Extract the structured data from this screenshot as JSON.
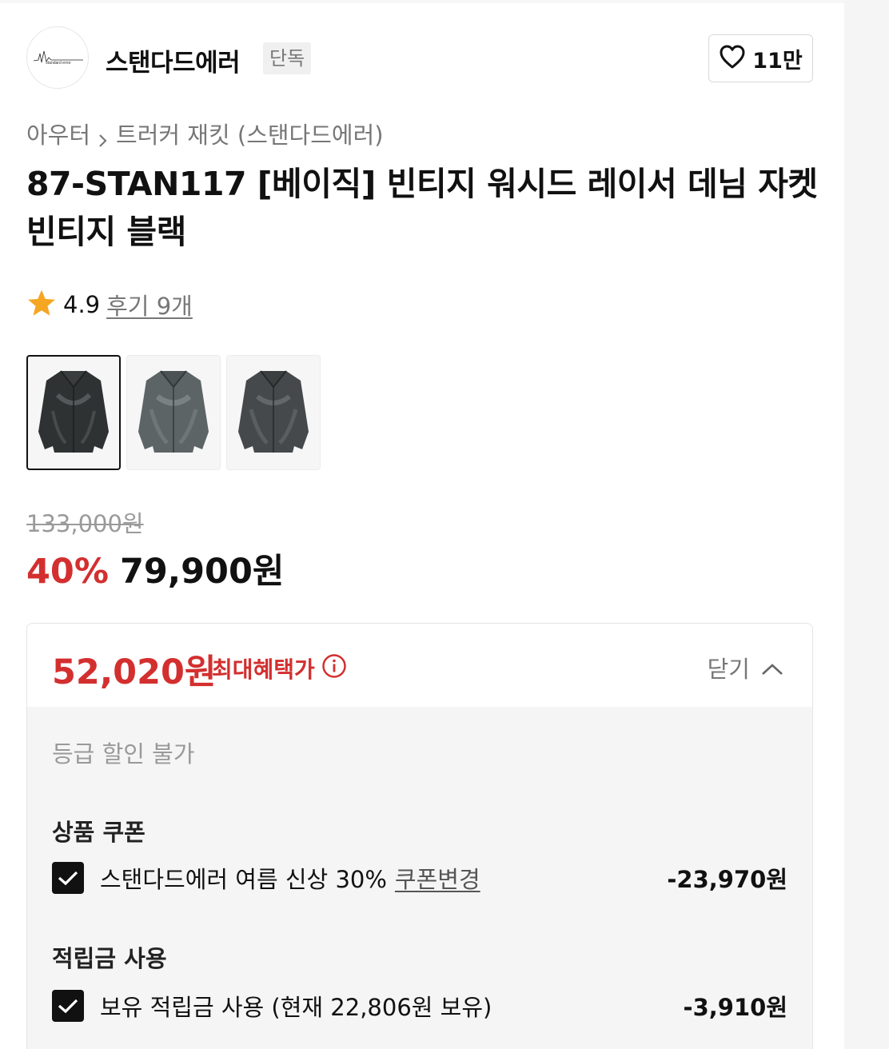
{
  "brand": {
    "name": "스탠다드에러",
    "badge": "단독",
    "logo_text": "standard error",
    "like_count": "11만"
  },
  "breadcrumb": {
    "category": "아우터",
    "subcategory": "트러커 재킷 (스탠다드에러)"
  },
  "product": {
    "title_line1": "87-STAN117 [베이직] 빈티지 워시드 레이서 데님 자켓",
    "title_line2": "빈티지 블랙"
  },
  "rating": {
    "score": "4.9",
    "reviews": "후기 9개"
  },
  "thumbnails": [
    {
      "label": "jacket-front-black",
      "selected": true
    },
    {
      "label": "jacket-front-grey",
      "selected": false
    },
    {
      "label": "jacket-front-dark",
      "selected": false
    }
  ],
  "price": {
    "original": "133,000원",
    "discount": "40%",
    "sale": "79,900원"
  },
  "benefit": {
    "max_price": "52,020원",
    "max_label": "최대혜택가",
    "collapse": "닫기",
    "grade_note": "등급 할인 불가",
    "coupon_section": "상품 쿠폰",
    "coupon_name": "스탠다드에러 여름 신상 30%",
    "coupon_change": "쿠폰변경",
    "coupon_amount": "-23,970원",
    "points_section": "적립금 사용",
    "points_text": "보유 적립금 사용 (현재 22,806원 보유)",
    "points_amount": "-3,910원"
  },
  "colors": {
    "accent_red": "#d32f2f",
    "text": "#111111",
    "muted": "#777777",
    "panel": "#f5f5f5"
  },
  "icons": [
    "heart-icon",
    "chevron-right-icon",
    "star-icon",
    "info-icon",
    "chevron-up-icon",
    "checkmark-icon"
  ]
}
